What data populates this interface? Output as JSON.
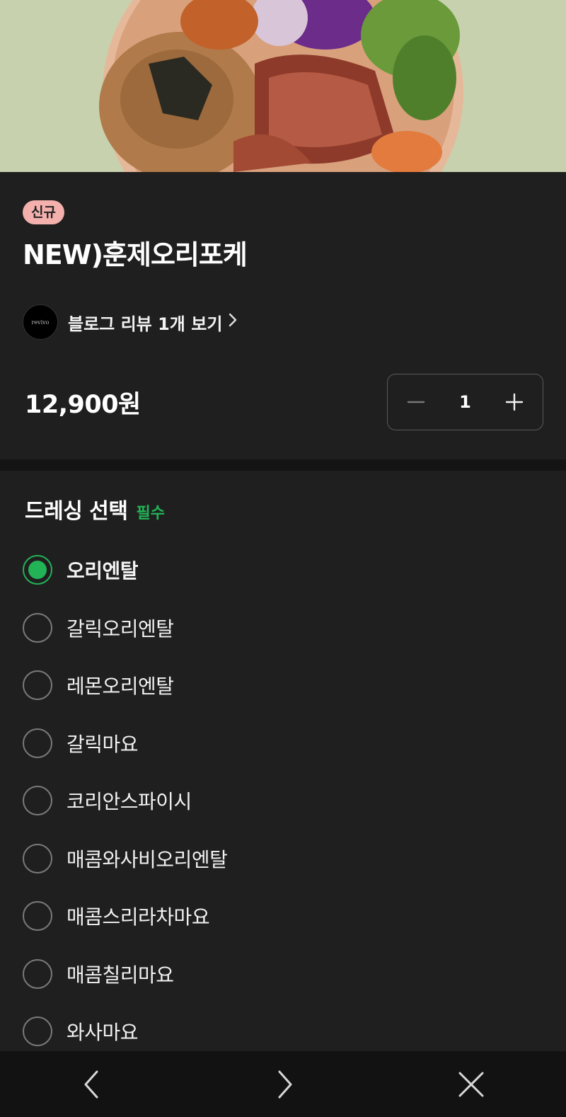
{
  "product": {
    "badge": "신규",
    "title": "NEW)훈제오리포케",
    "review_avatar_text": "revivo",
    "review_link": "블로그 리뷰 1개 보기",
    "price": "12,900원",
    "quantity": "1"
  },
  "dressing": {
    "title": "드레싱 선택",
    "required_label": "필수",
    "options": [
      {
        "label": "오리엔탈",
        "selected": true
      },
      {
        "label": "갈릭오리엔탈",
        "selected": false
      },
      {
        "label": "레몬오리엔탈",
        "selected": false
      },
      {
        "label": "갈릭마요",
        "selected": false
      },
      {
        "label": "코리안스파이시",
        "selected": false
      },
      {
        "label": "매콤와사비오리엔탈",
        "selected": false
      },
      {
        "label": "매콤스리라차마요",
        "selected": false
      },
      {
        "label": "매콤칠리마요",
        "selected": false
      },
      {
        "label": "와사마요",
        "selected": false
      }
    ]
  },
  "icons": {
    "back": "chevron-left-icon",
    "forward": "chevron-right-icon",
    "close": "close-icon",
    "minus": "minus-icon",
    "plus": "plus-icon"
  },
  "colors": {
    "accent_green": "#22b357",
    "badge_pink": "#f4b0ad",
    "background": "#1f1f1f"
  }
}
